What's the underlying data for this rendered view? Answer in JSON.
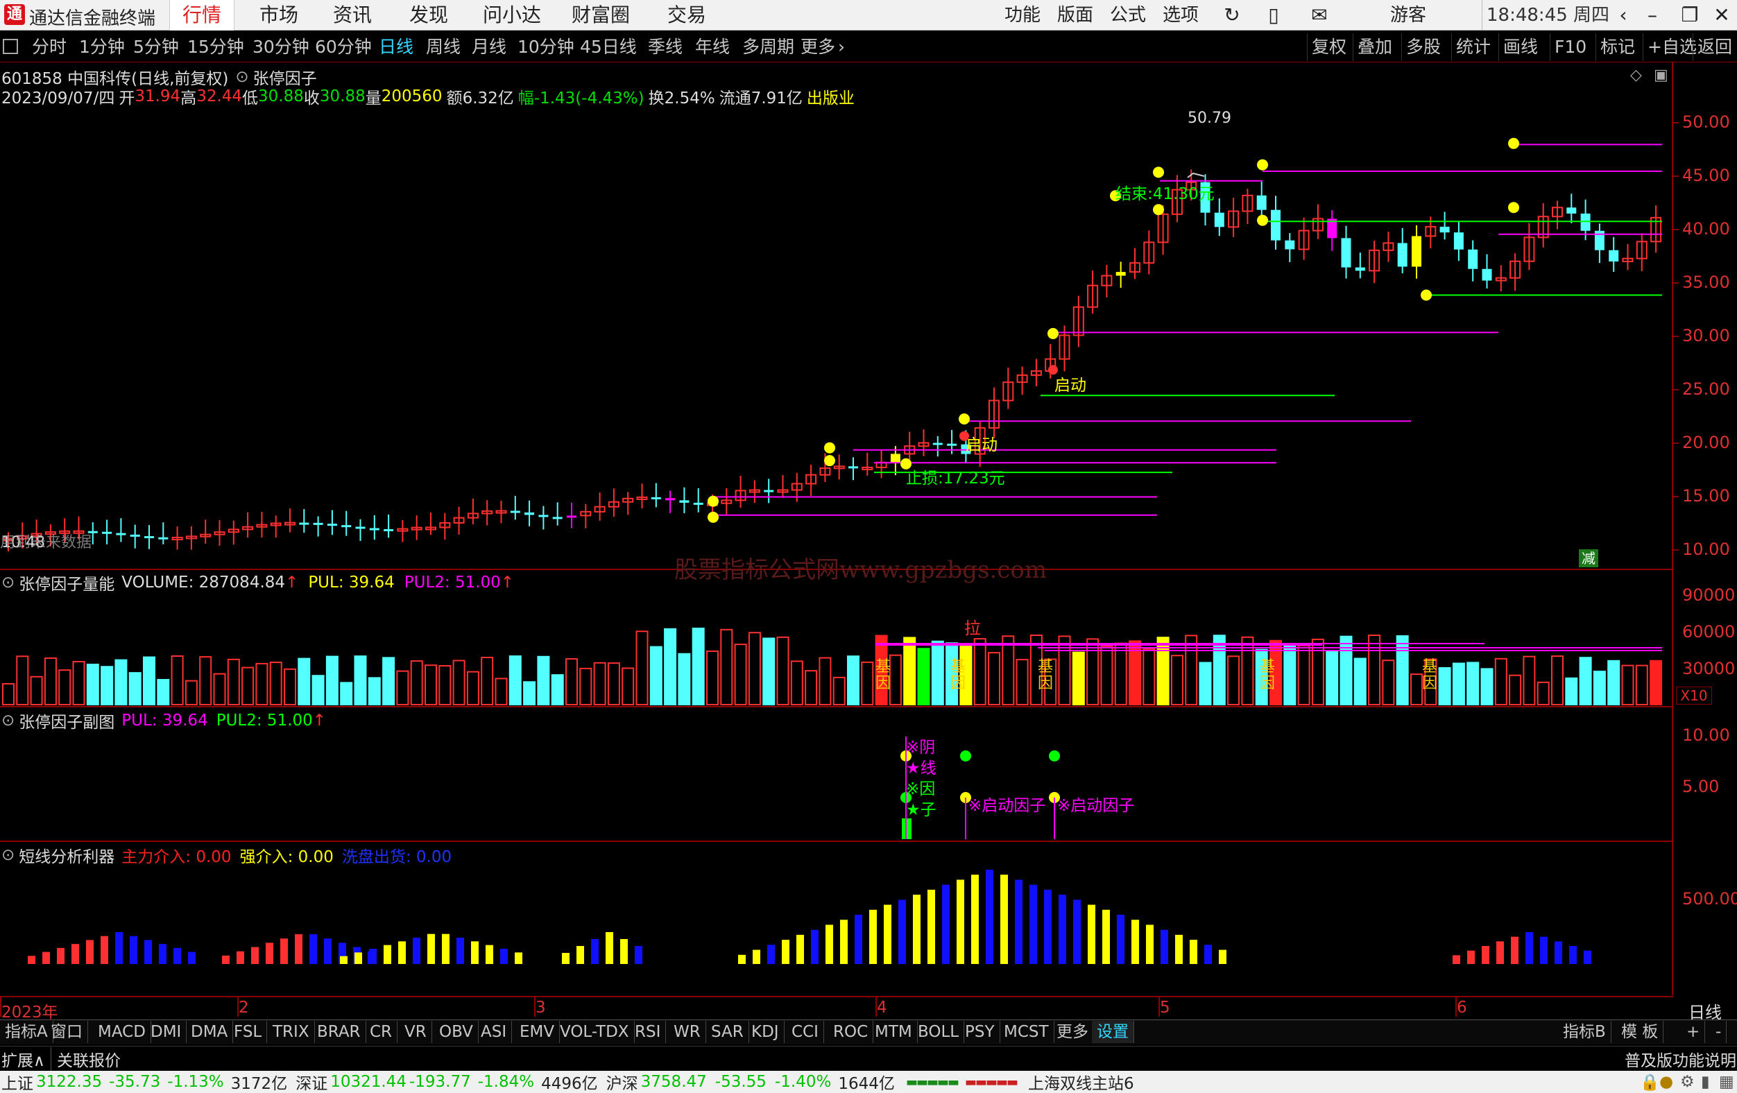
{
  "app": {
    "logo_text": "通",
    "title": "通达信金融终端",
    "menus": [
      {
        "label": "行情",
        "active": true
      },
      {
        "label": "市场",
        "active": false
      },
      {
        "label": "资讯",
        "active": false
      },
      {
        "label": "发现",
        "active": false
      },
      {
        "label": "问小达",
        "active": false
      },
      {
        "label": "财富圈",
        "active": false
      },
      {
        "label": "交易",
        "active": false
      }
    ],
    "right_tools": [
      "功能",
      "版面",
      "公式",
      "选项"
    ],
    "user": "游客",
    "clock": "18:48:45 周四"
  },
  "periods": [
    {
      "label": "分时",
      "active": false
    },
    {
      "label": "1分钟",
      "active": false
    },
    {
      "label": "5分钟",
      "active": false
    },
    {
      "label": "15分钟",
      "active": false
    },
    {
      "label": "30分钟",
      "active": false
    },
    {
      "label": "60分钟",
      "active": false
    },
    {
      "label": "日线",
      "active": true
    },
    {
      "label": "周线",
      "active": false
    },
    {
      "label": "月线",
      "active": false
    },
    {
      "label": "10分钟",
      "active": false
    },
    {
      "label": "45日线",
      "active": false
    },
    {
      "label": "季线",
      "active": false
    },
    {
      "label": "年线",
      "active": false
    },
    {
      "label": "多周期",
      "active": false
    },
    {
      "label": "更多",
      "active": false
    }
  ],
  "right_buttons": [
    "复权",
    "叠加",
    "多股",
    "统计",
    "画线",
    "F10",
    "标记",
    "+自选",
    "返回"
  ],
  "stock": {
    "header": "601858 中国科传(日线,前复权)",
    "indicator": "张停因子",
    "date": "2023/09/07/四",
    "open_label": "开",
    "open": "31.94",
    "high_label": "高",
    "high": "32.44",
    "low_label": "低",
    "low": "30.88",
    "close_label": "收",
    "close": "30.88",
    "vol_label": "量",
    "vol": "200560",
    "amount": "额6.32亿",
    "change": "幅-1.43(-4.43%)",
    "turnover": "换2.54%",
    "float": "流通7.91亿",
    "sector": "出版业"
  },
  "main_chart": {
    "y_labels": [
      "50.00",
      "45.00",
      "40.00",
      "35.00",
      "30.00",
      "25.00",
      "20.00",
      "15.00",
      "10.00"
    ],
    "max_label": "50.79",
    "min_label": "10.48",
    "annotations": {
      "end": "结束:41.30元",
      "start1": "启动",
      "start2": "启动",
      "support": "止损:17.23元",
      "left_note": "用到未来数据",
      "reduce": "减"
    }
  },
  "vol_pane": {
    "title": "张停因子量能",
    "volume_label": "VOLUME: 287084.84",
    "pul": "PUL: 39.64",
    "pul2": "PUL2: 51.00",
    "y_labels": [
      "90000",
      "60000",
      "30000"
    ],
    "unit": "X10",
    "lbl_la": "拉",
    "lbl_ji": "基因"
  },
  "sub_pane": {
    "title": "张停因子副图",
    "pul": "PUL: 39.64",
    "pul2": "PUL2: 51.00",
    "y_labels": [
      "10.00",
      "5.00"
    ],
    "lbl_yin": "※阴",
    "lbl_xian": "★线",
    "lbl_yinzi": "※因",
    "lbl_zi": "★子",
    "lbl_start": "※启动因子"
  },
  "short_pane": {
    "title": "短线分析利器",
    "main": "主力介入: 0.00",
    "strong": "强介入: 0.00",
    "wash": "洗盘出货: 0.00",
    "y_labels": [
      "500.00"
    ]
  },
  "watermark": "股票指标公式网www.gpzbgs.com",
  "x_axis": [
    "2023年",
    "2",
    "3",
    "4",
    "5",
    "6"
  ],
  "x_right": "日线",
  "indicators": [
    {
      "label": "指标A",
      "active": false
    },
    {
      "label": "窗口",
      "active": false
    },
    {
      "label": "MACD",
      "active": false
    },
    {
      "label": "DMI",
      "active": false
    },
    {
      "label": "DMA",
      "active": false
    },
    {
      "label": "FSL",
      "active": false
    },
    {
      "label": "TRIX",
      "active": false
    },
    {
      "label": "BRAR",
      "active": false
    },
    {
      "label": "CR",
      "active": false
    },
    {
      "label": "VR",
      "active": false
    },
    {
      "label": "OBV",
      "active": false
    },
    {
      "label": "ASI",
      "active": false
    },
    {
      "label": "EMV",
      "active": false
    },
    {
      "label": "VOL-TDX",
      "active": false
    },
    {
      "label": "RSI",
      "active": false
    },
    {
      "label": "WR",
      "active": false
    },
    {
      "label": "SAR",
      "active": false
    },
    {
      "label": "KDJ",
      "active": false
    },
    {
      "label": "CCI",
      "active": false
    },
    {
      "label": "ROC",
      "active": false
    },
    {
      "label": "MTM",
      "active": false
    },
    {
      "label": "BOLL",
      "active": false
    },
    {
      "label": "PSY",
      "active": false
    },
    {
      "label": "MCST",
      "active": false
    },
    {
      "label": "更多",
      "active": false
    },
    {
      "label": "设置",
      "active": true
    }
  ],
  "indicator_right": [
    "指标B",
    "模 板",
    "+",
    "-"
  ],
  "ext": {
    "expand": "扩展∧",
    "related": "关联报价",
    "right": "普及版功能说明"
  },
  "status": {
    "sh_label": "上证",
    "sh": "3122.35",
    "sh_chg": "-35.73",
    "sh_pct": "-1.13%",
    "sh_amt": "3172亿",
    "sz_label": "深证",
    "sz": "10321.44",
    "sz_chg": "-193.77",
    "sz_pct": "-1.84%",
    "sz_amt": "4496亿",
    "hs_label": "沪深",
    "hs": "3758.47",
    "hs_chg": "-53.55",
    "hs_pct": "-1.40%",
    "hs_amt": "1644亿",
    "server": "上海双线主站6"
  },
  "colors": {
    "up": "#ff3030",
    "down": "#54ffff",
    "yellow": "#ffff00",
    "magenta": "#ff00ff",
    "green": "#00ff00",
    "blue": "#1010ff"
  }
}
